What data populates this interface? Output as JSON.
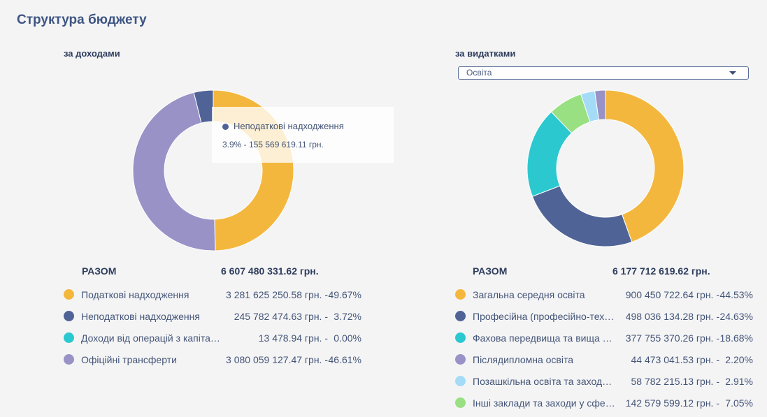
{
  "page_title": "Структура бюджету",
  "income": {
    "title": "за доходами",
    "total_label": "РАЗОМ",
    "total_value": "6 607 480 331.62 грн.",
    "tooltip": {
      "name": "Неподаткові надходження",
      "value": "3.9% - 155 569 619.11 грн.",
      "color": "#4f6396"
    },
    "legend": [
      {
        "name": "Податкові надходження",
        "amount": "3 281 625 250.58 грн. -",
        "pct": "49.67%",
        "color": "#f4b73e"
      },
      {
        "name": "Неподаткові надходження",
        "amount": "245 782 474.63 грн. -",
        "pct": "3.72%",
        "color": "#4f6396"
      },
      {
        "name": "Доходи від операцій з капітало…",
        "amount": "13 478.94 грн. -",
        "pct": "0.00%",
        "color": "#2bc9cf"
      },
      {
        "name": "Офіційні трансферти",
        "amount": "3 080 059 127.47 грн. -",
        "pct": "46.61%",
        "color": "#9892c7"
      }
    ]
  },
  "expense": {
    "title": "за видатками",
    "filter_value": "Освіта",
    "total_label": "РАЗОМ",
    "total_value": "6 177 712 619.62 грн.",
    "legend": [
      {
        "name": "Загальна середня освіта",
        "amount": "900 450 722.64 грн. -",
        "pct": "44.53%",
        "color": "#f4b73e"
      },
      {
        "name": "Професійна (професійно-технічна)…",
        "amount": "498 036 134.28 грн. -",
        "pct": "24.63%",
        "color": "#4f6396"
      },
      {
        "name": "Фахова передвища та вища освіта…",
        "amount": "377 755 370.26 грн. -",
        "pct": "18.68%",
        "color": "#2bc9cf"
      },
      {
        "name": "Післядипломна освіта",
        "amount": "44 473 041.53 грн. -",
        "pct": "2.20%",
        "color": "#9892c7"
      },
      {
        "name": "Позашкільна освіта та заходи…",
        "amount": "58 782 215.13 грн. -",
        "pct": "2.91%",
        "color": "#a4dcf8"
      },
      {
        "name": "Інші заклади та заходи у сфері…",
        "amount": "142 579 599.12 грн. -",
        "pct": "7.05%",
        "color": "#98e081"
      }
    ]
  },
  "chart_data": [
    {
      "type": "pie",
      "title": "за доходами",
      "categories": [
        "Податкові надходження",
        "Неподаткові надходження",
        "Доходи від операцій з капіталом",
        "Офіційні трансферти"
      ],
      "values": [
        49.67,
        3.9,
        0.0,
        46.61
      ],
      "colors": [
        "#f4b73e",
        "#4f6396",
        "#2bc9cf",
        "#9892c7"
      ],
      "order": [
        0,
        3,
        1
      ]
    },
    {
      "type": "pie",
      "title": "за видатками",
      "categories": [
        "Загальна середня освіта",
        "Професійна (професійно-технічна) освіта",
        "Фахова передвища та вища освіта",
        "Інші заклади та заходи у сфері освіти",
        "Позашкільна освіта та заходи",
        "Післядипломна освіта"
      ],
      "values": [
        44.53,
        24.63,
        18.68,
        7.05,
        2.91,
        2.2
      ],
      "colors": [
        "#f4b73e",
        "#4f6396",
        "#2bc9cf",
        "#98e081",
        "#a4dcf8",
        "#9892c7"
      ]
    }
  ]
}
